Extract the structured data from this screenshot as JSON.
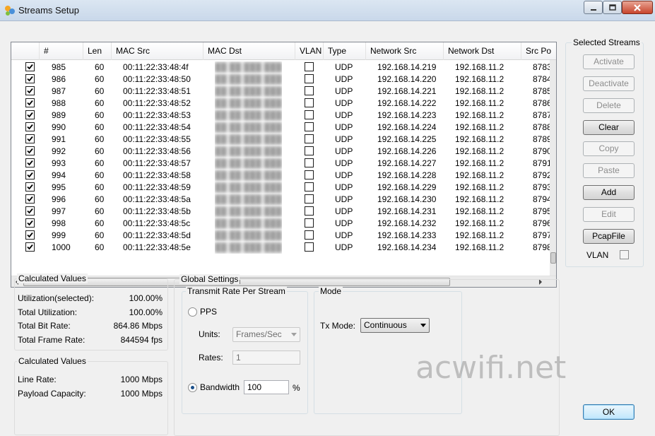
{
  "window": {
    "title": "Streams Setup"
  },
  "columns": [
    "#",
    "Len",
    "MAC Src",
    "MAC Dst",
    "VLAN",
    "Type",
    "Network Src",
    "Network Dst",
    "Src Po"
  ],
  "rows": [
    {
      "n": "985",
      "len": "60",
      "mac_src": "00:11:22:33:48:4f",
      "type": "UDP",
      "net_src": "192.168.14.219",
      "net_dst": "192.168.11.2",
      "src_port": "8783"
    },
    {
      "n": "986",
      "len": "60",
      "mac_src": "00:11:22:33:48:50",
      "type": "UDP",
      "net_src": "192.168.14.220",
      "net_dst": "192.168.11.2",
      "src_port": "8784"
    },
    {
      "n": "987",
      "len": "60",
      "mac_src": "00:11:22:33:48:51",
      "type": "UDP",
      "net_src": "192.168.14.221",
      "net_dst": "192.168.11.2",
      "src_port": "8785"
    },
    {
      "n": "988",
      "len": "60",
      "mac_src": "00:11:22:33:48:52",
      "type": "UDP",
      "net_src": "192.168.14.222",
      "net_dst": "192.168.11.2",
      "src_port": "8786"
    },
    {
      "n": "989",
      "len": "60",
      "mac_src": "00:11:22:33:48:53",
      "type": "UDP",
      "net_src": "192.168.14.223",
      "net_dst": "192.168.11.2",
      "src_port": "8787"
    },
    {
      "n": "990",
      "len": "60",
      "mac_src": "00:11:22:33:48:54",
      "type": "UDP",
      "net_src": "192.168.14.224",
      "net_dst": "192.168.11.2",
      "src_port": "8788"
    },
    {
      "n": "991",
      "len": "60",
      "mac_src": "00:11:22:33:48:55",
      "type": "UDP",
      "net_src": "192.168.14.225",
      "net_dst": "192.168.11.2",
      "src_port": "8789"
    },
    {
      "n": "992",
      "len": "60",
      "mac_src": "00:11:22:33:48:56",
      "type": "UDP",
      "net_src": "192.168.14.226",
      "net_dst": "192.168.11.2",
      "src_port": "8790"
    },
    {
      "n": "993",
      "len": "60",
      "mac_src": "00:11:22:33:48:57",
      "type": "UDP",
      "net_src": "192.168.14.227",
      "net_dst": "192.168.11.2",
      "src_port": "8791"
    },
    {
      "n": "994",
      "len": "60",
      "mac_src": "00:11:22:33:48:58",
      "type": "UDP",
      "net_src": "192.168.14.228",
      "net_dst": "192.168.11.2",
      "src_port": "8792"
    },
    {
      "n": "995",
      "len": "60",
      "mac_src": "00:11:22:33:48:59",
      "type": "UDP",
      "net_src": "192.168.14.229",
      "net_dst": "192.168.11.2",
      "src_port": "8793"
    },
    {
      "n": "996",
      "len": "60",
      "mac_src": "00:11:22:33:48:5a",
      "type": "UDP",
      "net_src": "192.168.14.230",
      "net_dst": "192.168.11.2",
      "src_port": "8794"
    },
    {
      "n": "997",
      "len": "60",
      "mac_src": "00:11:22:33:48:5b",
      "type": "UDP",
      "net_src": "192.168.14.231",
      "net_dst": "192.168.11.2",
      "src_port": "8795"
    },
    {
      "n": "998",
      "len": "60",
      "mac_src": "00:11:22:33:48:5c",
      "type": "UDP",
      "net_src": "192.168.14.232",
      "net_dst": "192.168.11.2",
      "src_port": "8796"
    },
    {
      "n": "999",
      "len": "60",
      "mac_src": "00:11:22:33:48:5d",
      "type": "UDP",
      "net_src": "192.168.14.233",
      "net_dst": "192.168.11.2",
      "src_port": "8797"
    },
    {
      "n": "1000",
      "len": "60",
      "mac_src": "00:11:22:33:48:5e",
      "type": "UDP",
      "net_src": "192.168.14.234",
      "net_dst": "192.168.11.2",
      "src_port": "8798"
    }
  ],
  "selected_streams": {
    "title": "Selected Streams",
    "buttons": {
      "activate": "Activate",
      "deactivate": "Deactivate",
      "delete": "Delete",
      "clear": "Clear",
      "copy": "Copy",
      "paste": "Paste",
      "add": "Add",
      "edit": "Edit",
      "pcapfile": "PcapFile"
    },
    "vlan_label": "VLAN"
  },
  "calc1": {
    "title": "Calculated Values",
    "rows": [
      {
        "label": "Utilization(selected):",
        "value": "100.00%"
      },
      {
        "label": "Total Utilization:",
        "value": "100.00%"
      },
      {
        "label": "Total Bit Rate:",
        "value": "864.86 Mbps"
      },
      {
        "label": "Total Frame Rate:",
        "value": "844594 fps"
      }
    ]
  },
  "calc2": {
    "title": "Calculated Values",
    "rows": [
      {
        "label": "Line Rate:",
        "value": "1000 Mbps"
      },
      {
        "label": "Payload Capacity:",
        "value": "1000 Mbps"
      }
    ]
  },
  "global": {
    "title": "Global Settings",
    "transmit_title": "Transmit Rate Per Stream",
    "pps_label": "PPS",
    "units_label": "Units:",
    "units_value": "Frames/Sec",
    "rates_label": "Rates:",
    "rates_value": "1",
    "bandwidth_label": "Bandwidth",
    "bandwidth_value": "100",
    "percent": "%",
    "mode_title": "Mode",
    "txmode_label": "Tx Mode:",
    "txmode_value": "Continuous"
  },
  "ok_label": "OK",
  "watermark": "acwifi.net"
}
